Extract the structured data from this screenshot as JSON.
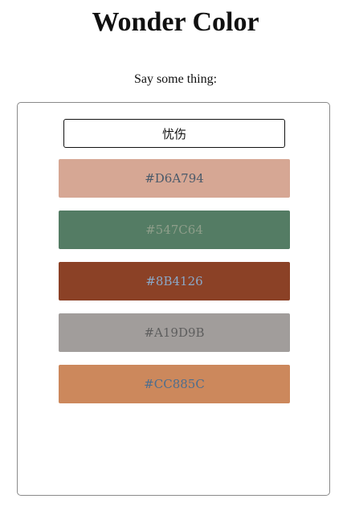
{
  "app": {
    "title": "Wonder Color",
    "prompt_label": "Say some thing:"
  },
  "input": {
    "value": "忧伤"
  },
  "swatches": [
    {
      "label": "#D6A794",
      "background": "#D6A794",
      "text_color": "#4A5A6A"
    },
    {
      "label": "#547C64",
      "background": "#547C64",
      "text_color": "#8E9E8A"
    },
    {
      "label": "#8B4126",
      "background": "#8B4126",
      "text_color": "#8AA8C8"
    },
    {
      "label": "#A19D9B",
      "background": "#A19D9B",
      "text_color": "#5E5E5E"
    },
    {
      "label": "#CC885C",
      "background": "#CC885C",
      "text_color": "#4E6E8E"
    }
  ]
}
